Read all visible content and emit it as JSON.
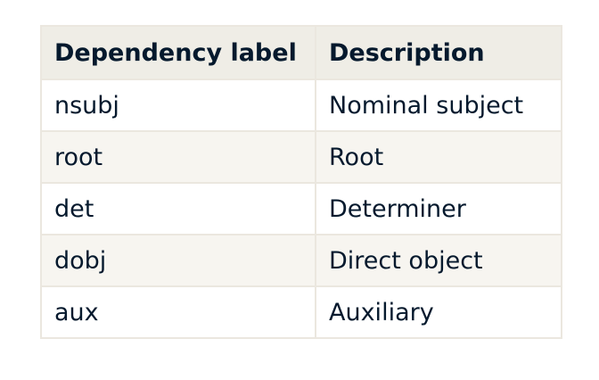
{
  "table": {
    "headers": [
      "Dependency label",
      "Description"
    ],
    "rows": [
      [
        "nsubj",
        "Nominal subject"
      ],
      [
        "root",
        "Root"
      ],
      [
        "det",
        "Determiner"
      ],
      [
        "dobj",
        "Direct object"
      ],
      [
        "aux",
        "Auxiliary"
      ]
    ]
  }
}
